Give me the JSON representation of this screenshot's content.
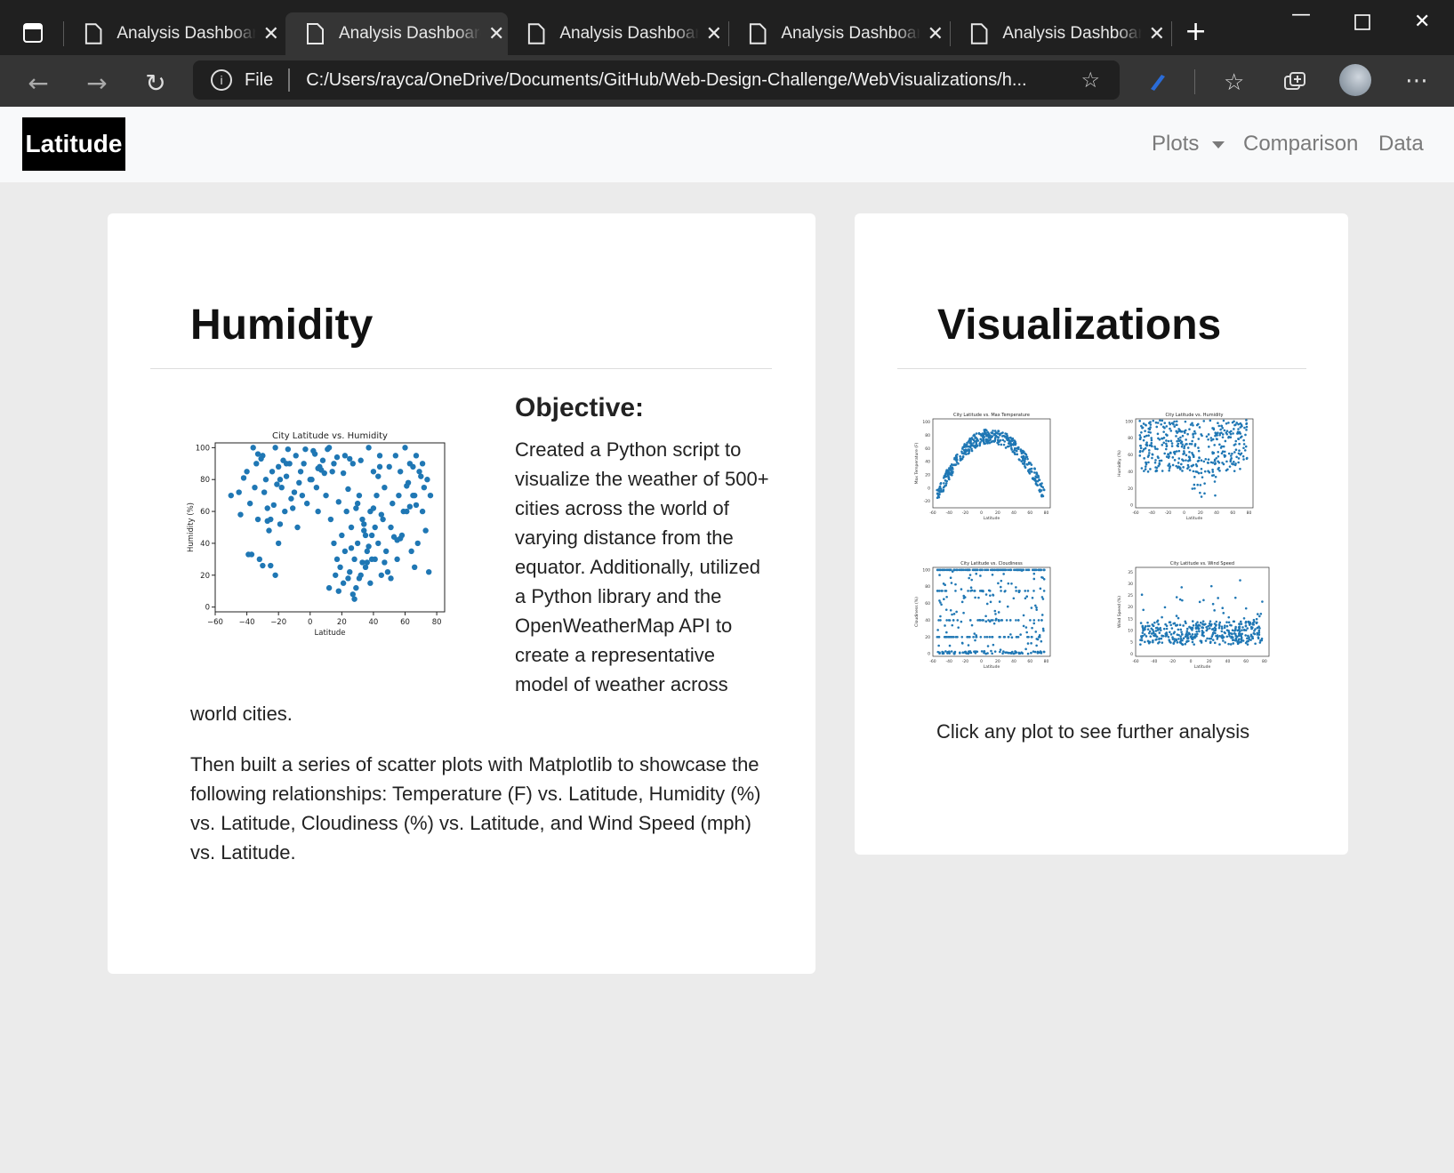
{
  "browser": {
    "tabs": [
      {
        "title": "Analysis Dashboard",
        "active": false
      },
      {
        "title": "Analysis Dashboard",
        "active": true
      },
      {
        "title": "Analysis Dashboard",
        "active": false
      },
      {
        "title": "Analysis Dashboard",
        "active": false
      },
      {
        "title": "Analysis Dashboard",
        "active": false
      }
    ],
    "address": {
      "scheme_label": "File",
      "url": "C:/Users/rayca/OneDrive/Documents/GitHub/Web-Design-Challenge/WebVisualizations/h..."
    }
  },
  "navbar": {
    "brand": "Latitude",
    "plots": "Plots",
    "comparison": "Comparison",
    "data": "Data"
  },
  "main": {
    "title": "Humidity",
    "objective_title": "Objective:",
    "objective_text": "Created a Python script to visualize the weather of 500+ cities across the world of varying distance from the equator. Additionally, utilized a Python library and the OpenWeatherMap API to create a representative model of weather across world cities.",
    "paragraph2": "Then built a series of scatter plots with Matplotlib to showcase the following relationships: Temperature (F) vs. Latitude, Humidity (%) vs. Latitude, Cloudiness (%) vs. Latitude, and Wind Speed (mph) vs. Latitude."
  },
  "sidebar": {
    "title": "Visualizations",
    "caption": "Click any plot to see further analysis"
  },
  "chart_data": [
    {
      "type": "scatter",
      "title": "City Latitude vs. Humidity",
      "xlabel": "Latitude",
      "ylabel": "Humidity (%)",
      "xlim": [
        -60,
        85
      ],
      "ylim": [
        -3,
        103
      ],
      "xticks": [
        -60,
        -40,
        -20,
        0,
        20,
        40,
        60,
        80
      ],
      "yticks": [
        0,
        20,
        40,
        60,
        80,
        100
      ],
      "x_tick_labels": [
        "−60",
        "−40",
        "−20",
        "0",
        "20",
        "40",
        "60",
        "80"
      ],
      "color": "#1f77b4",
      "x": [
        -50,
        -45,
        -42,
        -40,
        -38,
        -36,
        -35,
        -34,
        -33,
        -32,
        -30,
        -30,
        -28,
        -27,
        -26,
        -25,
        -24,
        -22,
        -22,
        -20,
        -20,
        -18,
        -17,
        -16,
        -15,
        -14,
        -12,
        -10,
        -9,
        -8,
        -6,
        -5,
        -4,
        -2,
        0,
        2,
        4,
        5,
        6,
        8,
        10,
        12,
        13,
        14,
        15,
        16,
        17,
        18,
        18,
        19,
        20,
        21,
        22,
        22,
        23,
        24,
        25,
        26,
        27,
        28,
        28,
        29,
        30,
        30,
        31,
        32,
        32,
        33,
        34,
        35,
        36,
        37,
        38,
        38,
        39,
        40,
        41,
        42,
        43,
        44,
        45,
        46,
        47,
        48,
        50,
        51,
        52,
        54,
        55,
        56,
        57,
        58,
        60,
        61,
        62,
        63,
        64,
        65,
        66,
        67,
        68,
        70,
        71,
        72,
        74,
        76,
        -44,
        -31,
        -29,
        -23,
        -19,
        -13,
        -7,
        3,
        9,
        11,
        24,
        26,
        34,
        36,
        40,
        44,
        47,
        53,
        59,
        66,
        69,
        73,
        -37,
        -25,
        -21,
        -11,
        1,
        7,
        15,
        21,
        27,
        31,
        33,
        37,
        41,
        45,
        49,
        55,
        61,
        65,
        67,
        75,
        -39,
        -33,
        -27,
        -19,
        -15,
        -3,
        5,
        12,
        17,
        25,
        29,
        35,
        39,
        43,
        51,
        57,
        63,
        71
      ],
      "y": [
        70,
        72,
        81,
        85,
        65,
        100,
        75,
        90,
        55,
        30,
        26,
        95,
        80,
        62,
        48,
        26,
        85,
        20,
        100,
        40,
        88,
        75,
        92,
        60,
        82,
        99,
        68,
        72,
        95,
        50,
        85,
        70,
        90,
        65,
        80,
        98,
        75,
        60,
        88,
        92,
        70,
        12,
        55,
        85,
        40,
        20,
        30,
        66,
        10,
        25,
        45,
        15,
        95,
        35,
        60,
        18,
        22,
        50,
        8,
        5,
        30,
        12,
        65,
        40,
        18,
        92,
        20,
        55,
        48,
        25,
        35,
        100,
        60,
        15,
        45,
        85,
        30,
        70,
        40,
        95,
        20,
        55,
        75,
        35,
        88,
        50,
        65,
        95,
        30,
        70,
        85,
        45,
        100,
        60,
        78,
        90,
        35,
        70,
        25,
        95,
        40,
        82,
        60,
        75,
        80,
        70,
        58,
        93,
        72,
        64,
        52,
        90,
        78,
        96,
        84,
        99,
        74,
        37,
        52,
        28,
        62,
        88,
        28,
        44,
        60,
        70,
        85,
        48,
        33,
        55,
        77,
        62,
        80,
        86,
        90,
        84,
        90,
        70,
        28,
        38,
        50,
        58,
        22,
        42,
        76,
        88,
        64,
        22,
        33,
        96,
        54,
        80,
        90,
        99,
        87,
        100,
        94,
        93,
        62,
        45,
        30,
        82,
        18,
        43,
        63,
        90,
        54,
        100
      ]
    },
    {
      "type": "scatter",
      "title": "City Latitude vs. Max Temperature",
      "xlabel": "Latitude",
      "ylabel": "Max Temperature (F)",
      "xlim": [
        -60,
        85
      ],
      "ylim": [
        -30,
        105
      ],
      "xticks": [
        -60,
        -40,
        -20,
        0,
        20,
        40,
        60,
        80
      ],
      "yticks": [
        -20,
        0,
        20,
        40,
        60,
        80,
        100
      ],
      "color": "#1f77b4"
    },
    {
      "type": "scatter",
      "title": "City Latitude vs. Humidity",
      "xlabel": "Latitude",
      "ylabel": "Humidity (%)",
      "xlim": [
        -60,
        85
      ],
      "ylim": [
        -3,
        103
      ],
      "xticks": [
        -60,
        -40,
        -20,
        0,
        20,
        40,
        60,
        80
      ],
      "yticks": [
        0,
        20,
        40,
        60,
        80,
        100
      ],
      "color": "#1f77b4"
    },
    {
      "type": "scatter",
      "title": "City Latitude vs. Cloudiness",
      "xlabel": "Latitude",
      "ylabel": "Cloudiness (%)",
      "xlim": [
        -60,
        85
      ],
      "ylim": [
        -3,
        103
      ],
      "xticks": [
        -60,
        -40,
        -20,
        0,
        20,
        40,
        60,
        80
      ],
      "yticks": [
        0,
        20,
        40,
        60,
        80,
        100
      ],
      "color": "#1f77b4"
    },
    {
      "type": "scatter",
      "title": "City Latitude vs. Wind Speed",
      "xlabel": "Latitude",
      "ylabel": "Wind Speed (%)",
      "xlim": [
        -60,
        85
      ],
      "ylim": [
        -1,
        37
      ],
      "xticks": [
        -60,
        -40,
        -20,
        0,
        20,
        40,
        60,
        80
      ],
      "yticks": [
        0,
        5,
        10,
        15,
        20,
        25,
        30,
        35
      ],
      "color": "#1f77b4"
    }
  ]
}
